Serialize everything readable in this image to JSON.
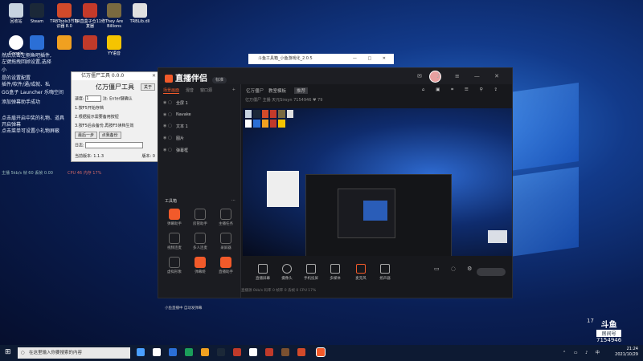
{
  "desktop": {
    "icons": [
      {
        "label": "回收站",
        "color": "#c7d3e0"
      },
      {
        "label": "Steam",
        "color": "#1b2838"
      },
      {
        "label": "TRBTools3节标识器 8.0",
        "color": "#d24a2a"
      },
      {
        "label": "TR直盒子仓11修复器",
        "color": "#c43a2a"
      },
      {
        "label": "They Are Billions",
        "color": "#7a6a40"
      },
      {
        "label": "TRBLib.dll",
        "color": "#e0e0e0"
      },
      {
        "label": "Google",
        "color": "#ffffff"
      },
      {
        "label": "",
        "color": "#2b6fd6"
      },
      {
        "label": "",
        "color": "#f0a020"
      },
      {
        "label": "",
        "color": "#c03a2a"
      },
      {
        "label": "YY语音",
        "color": "#f5c400"
      }
    ],
    "left_texts": [
      "然后点击左侧鱼吧插件,",
      "左键拖拽回顾设置,选择",
      "小",
      "是的设置配置",
      "插件/软件/通/成就、私",
      "GG盒子   Launcher   乐嗨空间",
      "添加弹幕助手成功",
      "点击盾开启中奖的礼物、道具",
      "开启弹幕",
      "点击菜单可设置小礼物屏蔽"
    ],
    "perf_left": "主播 5kb/s 帧 60 丢帧 0.00",
    "perf_right": "CPU 46 内存 17%"
  },
  "tool_window": {
    "title": "亿万僵尸工具 0.0.0",
    "heading": "亿万僵尸工具",
    "close_label": "关于",
    "speed_label": "速度:",
    "speed_value": "1",
    "speed_hint": "注: Enter键确认",
    "steps": [
      "1.按F5开始存档",
      "2.根据提示需要备用按钮",
      "3.按F5后会备份,再按F5读档生效"
    ],
    "btn_last": "最后一步",
    "btn_backup": "点我备份",
    "log_label": "日志:",
    "footer_left": "当前版本: 1.1.3",
    "footer_right": "版本: 0"
  },
  "mini_window": {
    "title": "斗鱼工具箱_小鱼游戏化_2.0.5"
  },
  "app": {
    "title": "直播伴侣",
    "badge": "标准",
    "left_tabs": [
      "场景画面",
      "混音",
      "窗口源"
    ],
    "scenes": [
      "全屏 1",
      "Navake",
      "文本 1",
      "图片",
      "弹幕框"
    ],
    "tools_heading": "工具箱",
    "tools": [
      {
        "label": "弹幕助手",
        "active": true
      },
      {
        "label": "房管助手",
        "active": false
      },
      {
        "label": "主播任务",
        "active": false
      },
      {
        "label": "视频连麦",
        "active": false
      },
      {
        "label": "多人连麦",
        "active": false
      },
      {
        "label": "录屏器",
        "active": false
      },
      {
        "label": "虚拟形象",
        "active": false
      },
      {
        "label": "弹幕姬",
        "active": true
      },
      {
        "label": "直播助手",
        "active": true
      }
    ],
    "sub_tabs": [
      "亿万僵尸",
      "教室模板",
      "推荐"
    ],
    "room_info": "亿万僵尸  主播  天元Sirsyn  7154946  ♥ 79",
    "bottom_tools": [
      "直播屏幕",
      "摄像头",
      "手机投屏",
      "多媒体",
      "麦克风",
      "扬声器"
    ],
    "status_text": "小鱼直播中 自动发弹幕",
    "right_stats": "直播源 0kb/s  码率 0  帧率 0  丢帧 0  CPU 17%"
  },
  "douyu": {
    "logo": "斗鱼",
    "sub": "房间号",
    "room": "7154946",
    "level": "17"
  },
  "taskbar": {
    "search_placeholder": "在这里输入你要搜索的内容",
    "time": "21:24",
    "date": "2021/10/29",
    "icons": [
      "#4aa0ff",
      "#ffffff",
      "#2b6fd6",
      "#1b9e5a",
      "#f0a020",
      "#1b2838",
      "#c03a2a",
      "#ffffff",
      "#c03a2a",
      "#7a5030",
      "#d24a2a",
      "#c43a2a",
      "#2b6fd6",
      "#f25a2a"
    ]
  }
}
